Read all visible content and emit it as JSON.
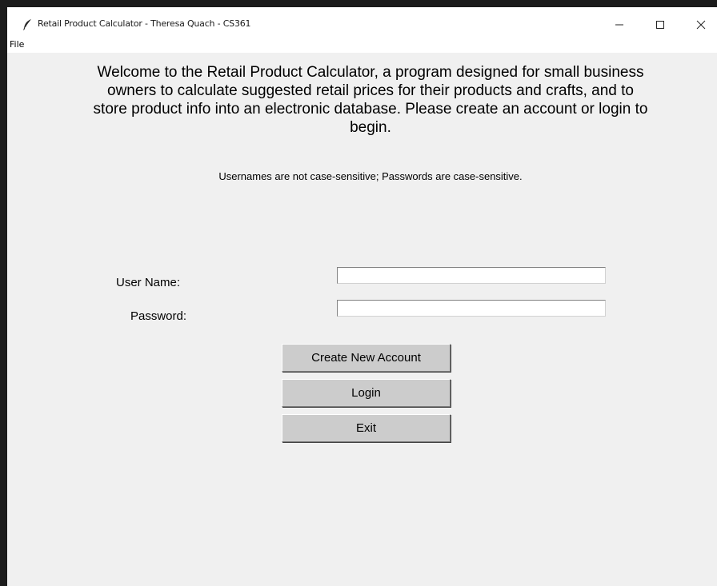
{
  "window": {
    "title": "Retail Product Calculator - Theresa Quach - CS361",
    "app_icon": "feather-icon",
    "controls": [
      "minimize-icon",
      "maximize-icon",
      "close-icon"
    ]
  },
  "menu": {
    "file_label": "File"
  },
  "content": {
    "welcome_line1": "Welcome to the Retail Product Calculator, a program designed for small business",
    "welcome_line2": "owners to calculate suggested retail prices for their products and crafts, and to",
    "welcome_line3": "store product info into an electronic database. Please create an account or login to",
    "welcome_line4": "begin.",
    "note": "Usernames are not case-sensitive; Passwords are case-sensitive."
  },
  "form": {
    "username_label": "User Name:",
    "username_value": "",
    "password_label": "Password:",
    "password_value": ""
  },
  "buttons": {
    "create_label": "Create New Account",
    "login_label": "Login",
    "exit_label": "Exit"
  },
  "colors": {
    "window_bg": "#f0f0f0",
    "titlebar_bg": "#ffffff",
    "button_bg": "#cccccc"
  }
}
